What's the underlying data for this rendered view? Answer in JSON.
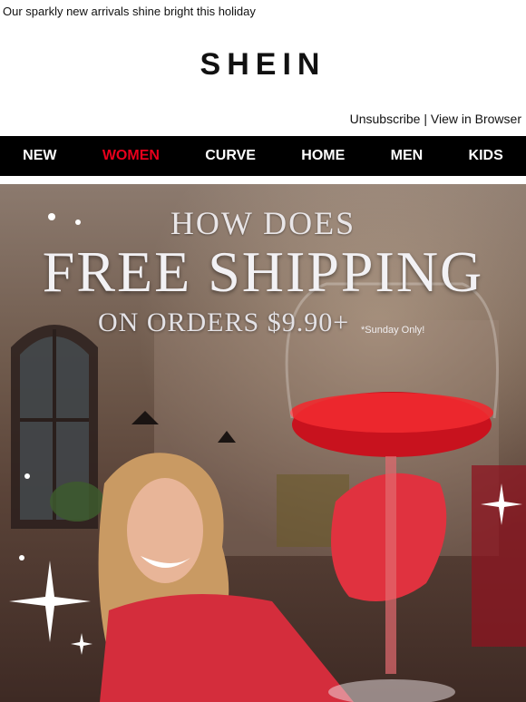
{
  "preheader": "Our sparkly new arrivals shine bright this holiday",
  "brand": {
    "logo": "SHEIN"
  },
  "util_links": {
    "unsubscribe": "Unsubscribe",
    "separator": " | ",
    "view_in_browser": "View in Browser"
  },
  "nav": {
    "items": [
      {
        "label": "NEW"
      },
      {
        "label": "WOMEN",
        "active": true
      },
      {
        "label": "CURVE"
      },
      {
        "label": "HOME"
      },
      {
        "label": "MEN"
      },
      {
        "label": "KIDS"
      }
    ],
    "active_color": "#e8001c",
    "background": "#000000"
  },
  "hero": {
    "line1": "HOW DOES",
    "line2": "FREE SHIPPING",
    "line3": "ON ORDERS $9.90+",
    "note": "*Sunday Only!",
    "icons": [
      "sparkle-icon",
      "wine-glass-image",
      "model-photo"
    ]
  }
}
